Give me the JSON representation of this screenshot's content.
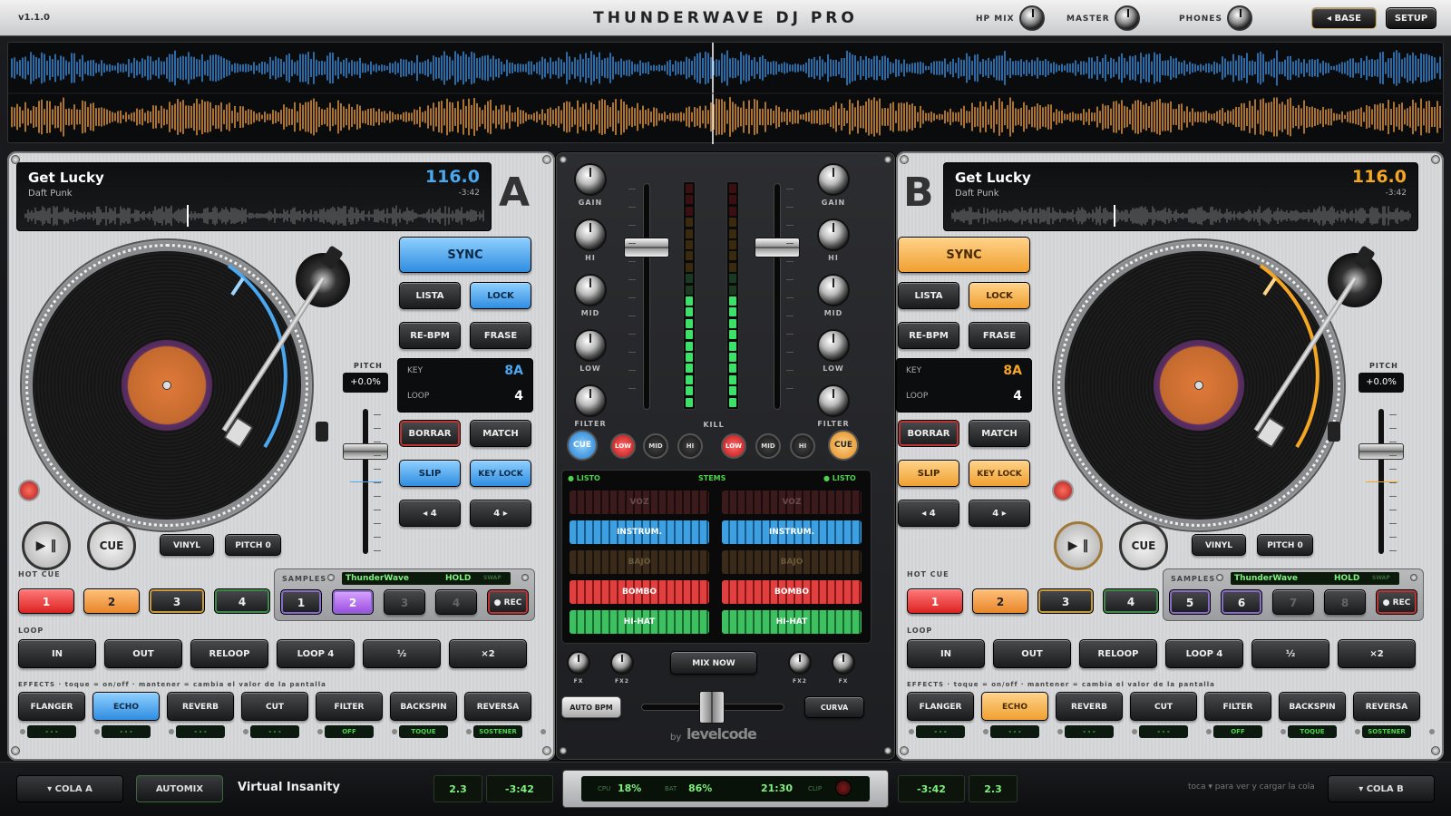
{
  "app": {
    "version": "v1.1.0",
    "title": "THUNDERWAVE DJ PRO"
  },
  "topbar": {
    "hp_mix": "HP MIX",
    "master": "MASTER",
    "phones": "PHONES",
    "base_btn": "◂ BASE",
    "setup_btn": "SETUP"
  },
  "colors": {
    "deckA": "#4aa8f0",
    "deckB": "#f5a623",
    "waveA": "#3b93e8",
    "waveB": "#f0a040"
  },
  "decks": [
    {
      "letter": "A",
      "title": "Get Lucky",
      "artist": "Daft Punk",
      "bpm": "116.0",
      "time": "-3:42",
      "sync": "SYNC",
      "lista": "LISTA",
      "lock": "LOCK",
      "rebpm": "RE-BPM",
      "frase": "FRASE",
      "key_label": "KEY",
      "key": "8A",
      "loop_label": "LOOP",
      "loop": "4",
      "borrar": "BORRAR",
      "match": "MATCH",
      "slip": "SLIP",
      "keylock": "KEY LOCK",
      "loop_back": "◂ 4",
      "loop_fwd": "4 ▸",
      "pitch_label": "PITCH",
      "pitch": "+0.0%",
      "play": "▶ ‖",
      "cue": "CUE",
      "vinyl": "VINYL",
      "pitch0": "PITCH 0",
      "hotcue_label": "HOT CUE",
      "hotcues": [
        "1",
        "2",
        "3",
        "4"
      ],
      "samples_label": "SAMPLES",
      "sample_name": "ThunderWave",
      "sample_hold": "HOLD",
      "sample_swap": "SWAP",
      "sample_pads": [
        "1",
        "2",
        "3",
        "4"
      ],
      "rec": "● REC",
      "loop_section": "LOOP",
      "loop_btns": [
        "IN",
        "OUT",
        "RELOOP",
        "LOOP 4",
        "½",
        "×2"
      ],
      "effects_label": "EFFECTS · toque = on/off · mantener = cambia el valor de la pantalla",
      "effects": [
        "FLANGER",
        "ECHO",
        "REVERB",
        "CUT",
        "FILTER",
        "BACKSPIN",
        "REVERSA"
      ],
      "effect_values": [
        "- - -",
        "- - -",
        "- - -",
        "- - -",
        "OFF",
        "TOQUE",
        "SOSTENER"
      ]
    },
    {
      "letter": "B",
      "title": "Get Lucky",
      "artist": "Daft Punk",
      "bpm": "116.0",
      "time": "-3:42",
      "sync": "SYNC",
      "lista": "LISTA",
      "lock": "LOCK",
      "rebpm": "RE-BPM",
      "frase": "FRASE",
      "key_label": "KEY",
      "key": "8A",
      "loop_label": "LOOP",
      "loop": "4",
      "borrar": "BORRAR",
      "match": "MATCH",
      "slip": "SLIP",
      "keylock": "KEY LOCK",
      "loop_back": "◂ 4",
      "loop_fwd": "4 ▸",
      "pitch_label": "PITCH",
      "pitch": "+0.0%",
      "play": "▶ ‖",
      "cue": "CUE",
      "vinyl": "VINYL",
      "pitch0": "PITCH 0",
      "hotcue_label": "HOT CUE",
      "hotcues": [
        "1",
        "2",
        "3",
        "4"
      ],
      "samples_label": "SAMPLES",
      "sample_name": "ThunderWave",
      "sample_hold": "HOLD",
      "sample_swap": "SWAP",
      "sample_pads": [
        "5",
        "6",
        "7",
        "8"
      ],
      "rec": "● REC",
      "loop_section": "LOOP",
      "loop_btns": [
        "IN",
        "OUT",
        "RELOOP",
        "LOOP 4",
        "½",
        "×2"
      ],
      "effects_label": "EFFECTS · toque = on/off · mantener = cambia el valor de la pantalla",
      "effects": [
        "FLANGER",
        "ECHO",
        "REVERB",
        "CUT",
        "FILTER",
        "BACKSPIN",
        "REVERSA"
      ],
      "effect_values": [
        "- - -",
        "- - -",
        "- - -",
        "- - -",
        "OFF",
        "TOQUE",
        "SOSTENER"
      ]
    }
  ],
  "mixer": {
    "knob_labels": [
      "GAIN",
      "HI",
      "MID",
      "LOW",
      "FILTER"
    ],
    "kill": "KILL",
    "cue": "CUE",
    "low": "LOW",
    "mid": "MID",
    "hi": "HI",
    "stems_title": "STEMS",
    "listo": "● LISTO",
    "stems": [
      "VOZ",
      "INSTRUM.",
      "BAJO",
      "BOMBO",
      "HI-HAT"
    ],
    "fx1": "FX",
    "fx2": "FX2",
    "mix_now": "MIX NOW",
    "auto_bpm": "AUTO BPM",
    "curva": "CURVA",
    "brand_by": "by",
    "brand": "levelcode"
  },
  "bottom": {
    "cola_a": "▾ COLA A",
    "automix": "AUTOMIX",
    "next_track": "Virtual Insanity",
    "left_box1": "2.3",
    "left_box2": "-3:42",
    "cpu_label": "CPU",
    "cpu": "18%",
    "bat_label": "BAT",
    "bat": "86%",
    "clock": "21:30",
    "clip_label": "CLIP",
    "right_box1": "-3:42",
    "right_box2": "2.3",
    "hint": "toca ▾ para ver y cargar la cola",
    "cola_b": "▾ COLA B"
  }
}
